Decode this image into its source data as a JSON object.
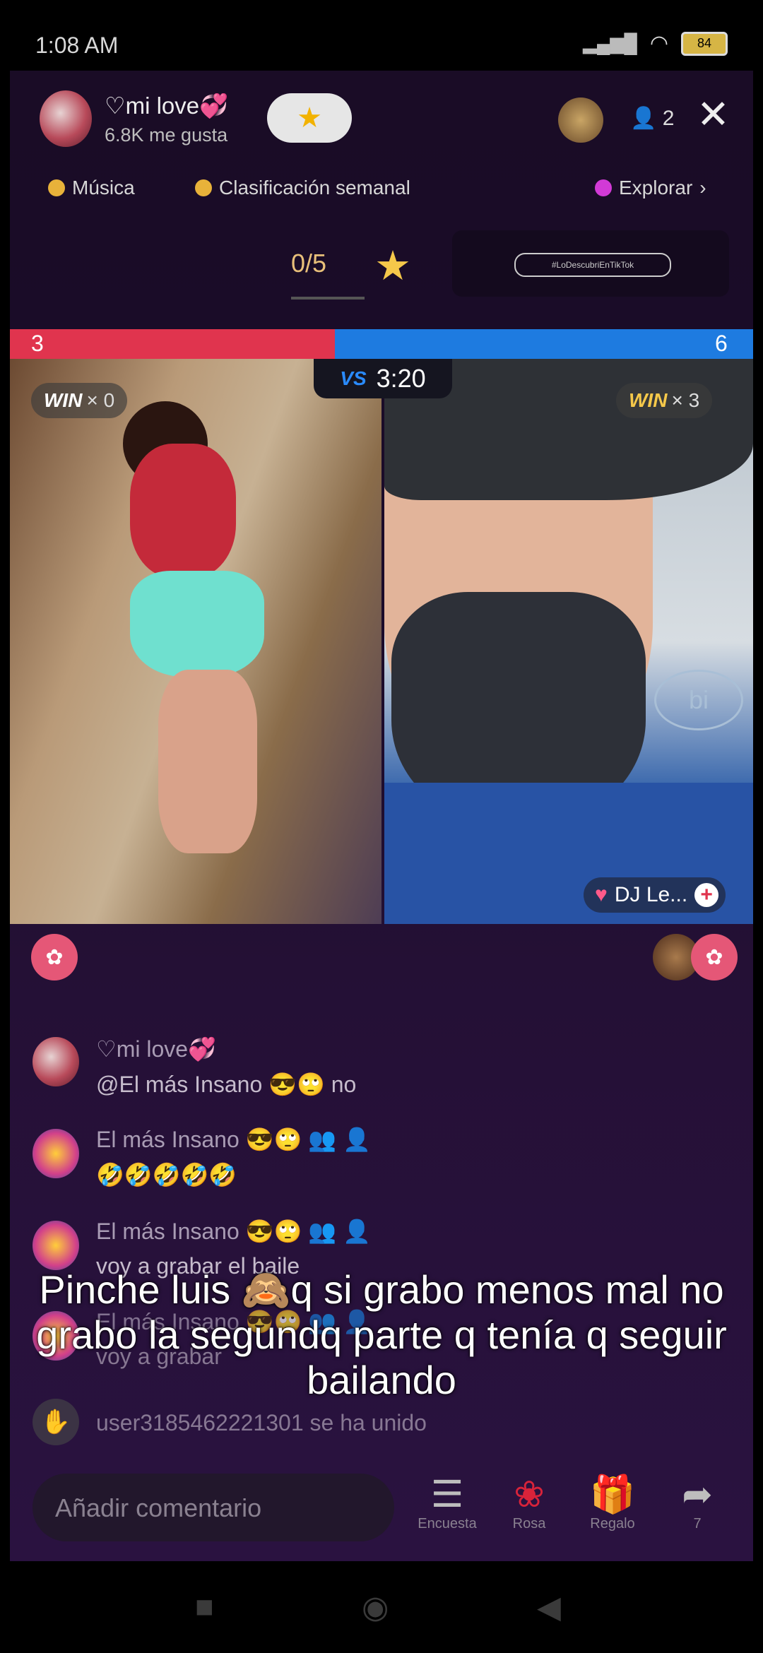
{
  "status": {
    "time": "1:08 AM",
    "battery": "84"
  },
  "host": {
    "name": "♡mi love💞",
    "likes": "6.8K me gusta"
  },
  "viewers": {
    "count": "2"
  },
  "nav_chips": {
    "music": "Música",
    "ranking": "Clasificación semanal",
    "explore": "Explorar"
  },
  "goal": {
    "progress": "0/5"
  },
  "promo": {
    "hashtag": "#LoDescubriEnTikTok"
  },
  "battle": {
    "left_score": "3",
    "right_score": "6",
    "vs": "VS",
    "timer": "3:20",
    "left_score_fraction": 0.333
  },
  "win": {
    "label": "WIN",
    "left": "× 0",
    "right": "× 3"
  },
  "opponent": {
    "tag": "DJ Le..."
  },
  "chat": [
    {
      "name": "♡mi love💞",
      "message": "@El más Insano 😎🙄 no"
    },
    {
      "name": "El más Insano 😎🙄 👥 👤",
      "message": "🤣🤣🤣🤣🤣"
    },
    {
      "name": "El más Insano 😎🙄 👥 👤",
      "message": "voy a grabar el baile"
    },
    {
      "name": "El más Insano 😎🙄 👥 👤",
      "message": "voy a grabar"
    },
    {
      "name": "",
      "message": "user3185462221301 se ha unido"
    }
  ],
  "caption": "Pinche luis 🙈q si grabo menos mal no grabo la segundq parte q tenía q seguir bailando",
  "bottom": {
    "comment_placeholder": "Añadir comentario",
    "poll": "Encuesta",
    "rose": "Rosa",
    "gift": "Regalo",
    "share_count": "7"
  },
  "colors": {
    "red": "#e0344e",
    "blue": "#1e7be0",
    "gold": "#f5c84a"
  }
}
